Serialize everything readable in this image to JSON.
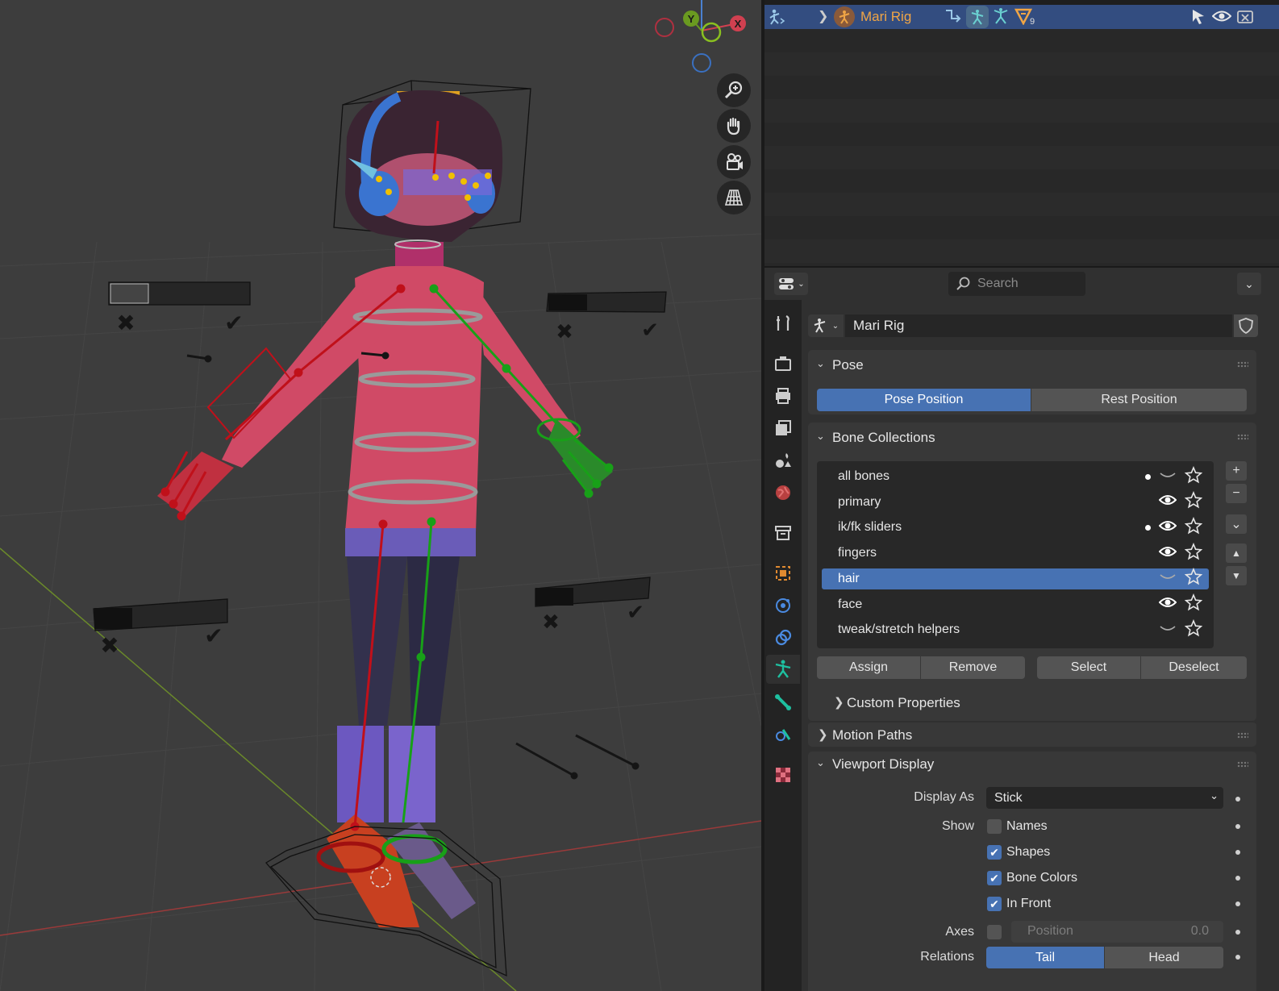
{
  "outliner": {
    "object_name": "Mari Rig",
    "modifier_count": "9"
  },
  "properties": {
    "search_placeholder": "Search",
    "object_name": "Mari Rig",
    "pose_panel": {
      "title": "Pose",
      "pose_position": "Pose Position",
      "rest_position": "Rest Position"
    },
    "bone_collections": {
      "title": "Bone Collections",
      "items": [
        {
          "label": "all bones",
          "dot": true,
          "visible": false,
          "selected": false
        },
        {
          "label": "primary",
          "dot": false,
          "visible": true,
          "selected": false
        },
        {
          "label": "ik/fk sliders",
          "dot": true,
          "visible": true,
          "selected": false
        },
        {
          "label": "fingers",
          "dot": false,
          "visible": true,
          "selected": false
        },
        {
          "label": "hair",
          "dot": false,
          "visible": false,
          "selected": true
        },
        {
          "label": "face",
          "dot": false,
          "visible": true,
          "selected": false
        },
        {
          "label": "tweak/stretch helpers",
          "dot": false,
          "visible": false,
          "selected": false
        }
      ],
      "assign": "Assign",
      "remove": "Remove",
      "select": "Select",
      "deselect": "Deselect",
      "custom_properties": "Custom Properties"
    },
    "motion_paths": {
      "title": "Motion Paths"
    },
    "viewport_display": {
      "title": "Viewport Display",
      "display_as_label": "Display As",
      "display_as_value": "Stick",
      "show_label": "Show",
      "names": {
        "label": "Names",
        "checked": false
      },
      "shapes": {
        "label": "Shapes",
        "checked": true
      },
      "bone_colors": {
        "label": "Bone Colors",
        "checked": true
      },
      "in_front": {
        "label": "In Front",
        "checked": true
      },
      "axes_label": "Axes",
      "axes_position_label": "Position",
      "axes_position_value": "0.0",
      "relations_label": "Relations",
      "tail": "Tail",
      "head": "Head"
    }
  },
  "gizmo": {
    "x": "X",
    "y": "Y"
  },
  "colors": {
    "accent": "#4772b3",
    "outliner_highlight": "#334d80",
    "object_name": "#f0a545",
    "bone_red": "#c0101a",
    "bone_green": "#18a018"
  }
}
